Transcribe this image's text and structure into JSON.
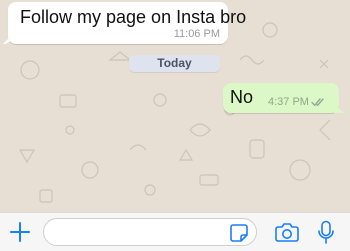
{
  "chat": {
    "messages": [
      {
        "direction": "incoming",
        "text": "Follow my page on Insta bro",
        "time": "11:06 PM"
      },
      {
        "direction": "outgoing",
        "text": "No",
        "time": "4:37 PM",
        "status_icon": "double-check-icon"
      }
    ],
    "date_separator": "Today"
  },
  "input_bar": {
    "message_value": "",
    "message_placeholder": "",
    "icons": {
      "attach": "plus-icon",
      "sticker": "sticker-icon",
      "camera": "camera-icon",
      "voice": "microphone-icon"
    }
  },
  "colors": {
    "wallpaper": "#e7ded4",
    "incoming_bubble": "#ffffff",
    "outgoing_bubble": "#dcf8c6",
    "accent": "#1a7dfa",
    "date_pill": "#dfe3f0"
  }
}
